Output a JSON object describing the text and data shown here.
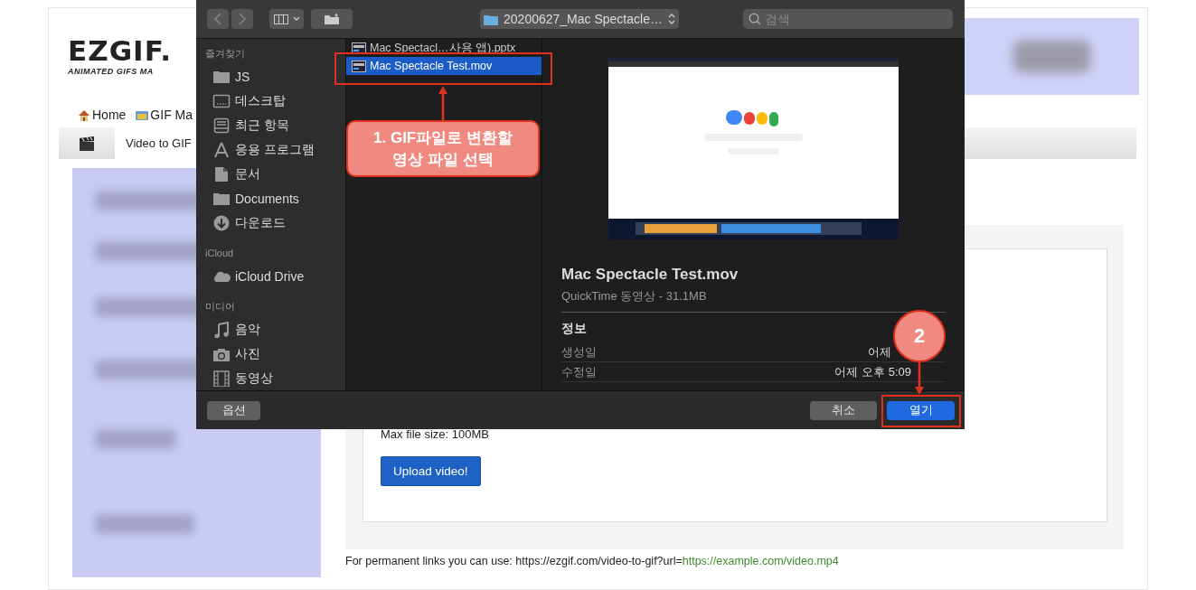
{
  "page": {
    "logo": {
      "title": "EZGIF.",
      "tagline": "ANIMATED GIFS MA"
    },
    "nav": [
      {
        "label": "Home"
      },
      {
        "label": "GIF Ma"
      }
    ],
    "tabs": [
      {
        "label": "Video to GIF",
        "selected": true
      }
    ],
    "upload": {
      "max_size": "Max file size: 100MB",
      "button": "Upload video!"
    },
    "footer": {
      "text": "For permanent links you can use: https://ezgif.com/video-to-gif?url=",
      "link": "https://example.com/video.mp4"
    }
  },
  "dialog": {
    "toolbar": {
      "path": "20200627_Mac Spectacle…",
      "search_placeholder": "검색"
    },
    "sidebar": [
      {
        "title": "즐겨찾기",
        "items": [
          {
            "label": "JS"
          },
          {
            "label": "데스크탑"
          },
          {
            "label": "최근 항목"
          },
          {
            "label": "응용 프로그램"
          },
          {
            "label": "문서"
          },
          {
            "label": "Documents"
          },
          {
            "label": "다운로드"
          }
        ]
      },
      {
        "title": "iCloud",
        "items": [
          {
            "label": "iCloud Drive"
          }
        ]
      },
      {
        "title": "미디어",
        "items": [
          {
            "label": "음악"
          },
          {
            "label": "사진"
          },
          {
            "label": "동영상"
          }
        ]
      }
    ],
    "files": [
      {
        "name": "Mac Spectacl…사용 앱).pptx",
        "selected": false
      },
      {
        "name": "Mac Spectacle Test.mov",
        "selected": true
      }
    ],
    "preview": {
      "title": "Mac Spectacle Test.mov",
      "subtitle": "QuickTime 동영상 - 31.1MB",
      "section": "정보",
      "rows": [
        {
          "label": "생성일",
          "value": "어제"
        },
        {
          "label": "수정일",
          "value": "어제 오후 5:09"
        }
      ]
    },
    "buttons": {
      "options": "옵션",
      "cancel": "취소",
      "open": "열기"
    }
  },
  "annotations": {
    "callout": "1. GIF파일로 변환할\n영상 파일 선택",
    "marker": "2"
  }
}
